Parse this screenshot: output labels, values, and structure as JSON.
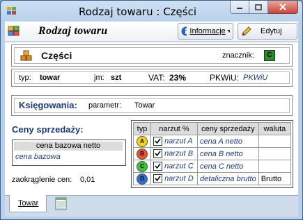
{
  "window": {
    "title": "Rodzaj towaru : Części"
  },
  "toolbar": {
    "title": "Rodzaj towaru",
    "info_label": "Informacje",
    "edit_label": "Edytuj"
  },
  "header": {
    "name": "Części",
    "marker_label": "znacznik:",
    "marker_value": "C",
    "marker_color": "#2f8a2f"
  },
  "details": {
    "type_label": "typ:",
    "type_value": "towar",
    "unit_label": "jm:",
    "unit_value": "szt",
    "vat_label": "VAT:",
    "vat_value": "23%",
    "pkwiu_label": "PKWiU:",
    "pkwiu_value": "PKWiU"
  },
  "accounting": {
    "title": "Księgowania:",
    "param_label": "parametr:",
    "param_value": "Towar"
  },
  "prices": {
    "title": "Ceny sprzedaży:",
    "base_header": "cena bazowa netto",
    "base_value": "cena bazowa",
    "rounding_label": "zaokrąglenie cen:",
    "rounding_value": "0,01",
    "columns": [
      "typ",
      "narzut %",
      "ceny sprzedaży",
      "waluta"
    ],
    "rows": [
      {
        "badge": "A",
        "color": "#f2d21b",
        "markup": "narzut A",
        "price": "cena A netto",
        "currency": ""
      },
      {
        "badge": "B",
        "color": "#e8542d",
        "markup": "narzut B",
        "price": "cena B netto",
        "currency": ""
      },
      {
        "badge": "C",
        "color": "#3cc23c",
        "markup": "narzut C",
        "price": "cena C netto",
        "currency": ""
      },
      {
        "badge": "D",
        "color": "#2f6fd0",
        "markup": "narzut D",
        "price": "detaliczna brutto",
        "currency": "Brutto"
      }
    ]
  },
  "tabs": {
    "first": "Towar"
  }
}
